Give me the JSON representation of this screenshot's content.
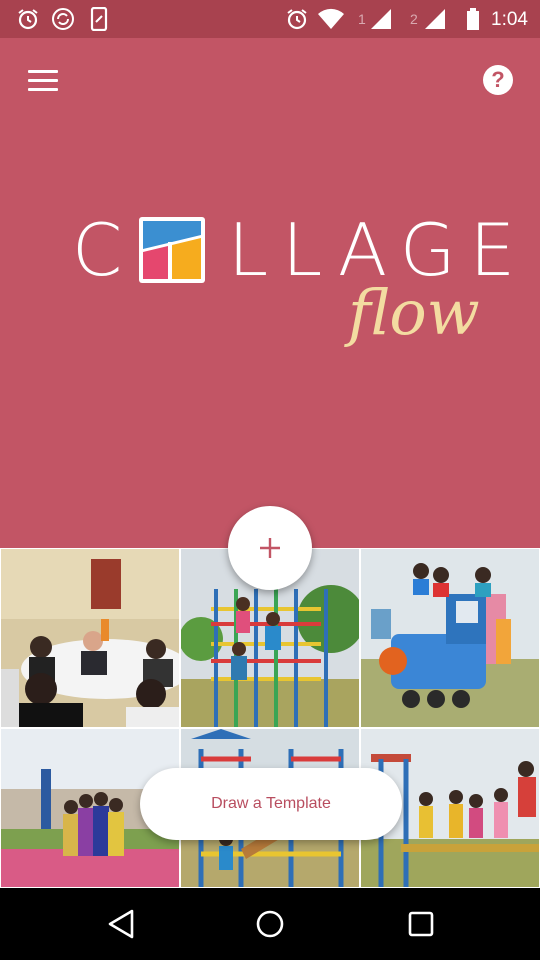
{
  "status_bar": {
    "time": "1:04",
    "sim1": "1",
    "sim2": "2",
    "icons": [
      "alarm-icon",
      "sync-icon",
      "phone-icon",
      "alarm-icon",
      "wifi-icon",
      "signal-icon",
      "signal-icon",
      "battery-icon"
    ]
  },
  "header": {
    "menu_icon": "menu-icon",
    "help_label": "?"
  },
  "logo": {
    "letter_c": "C",
    "letters_rest": "LLAGE",
    "script": "flow"
  },
  "photos": [
    {
      "name": "photo-meeting",
      "desc_icon": "photo"
    },
    {
      "name": "photo-playground-climb",
      "desc_icon": "photo"
    },
    {
      "name": "photo-toy-train",
      "desc_icon": "photo"
    },
    {
      "name": "photo-girls-group",
      "desc_icon": "photo"
    },
    {
      "name": "photo-playground-slide",
      "desc_icon": "photo"
    },
    {
      "name": "photo-kids-bridge",
      "desc_icon": "photo"
    }
  ],
  "actions": {
    "add_icon": "plus-icon",
    "draw_template_label": "Draw a Template"
  },
  "colors": {
    "brand": "#c25565",
    "status": "#a8424f",
    "accent_script": "#f3dca1"
  }
}
